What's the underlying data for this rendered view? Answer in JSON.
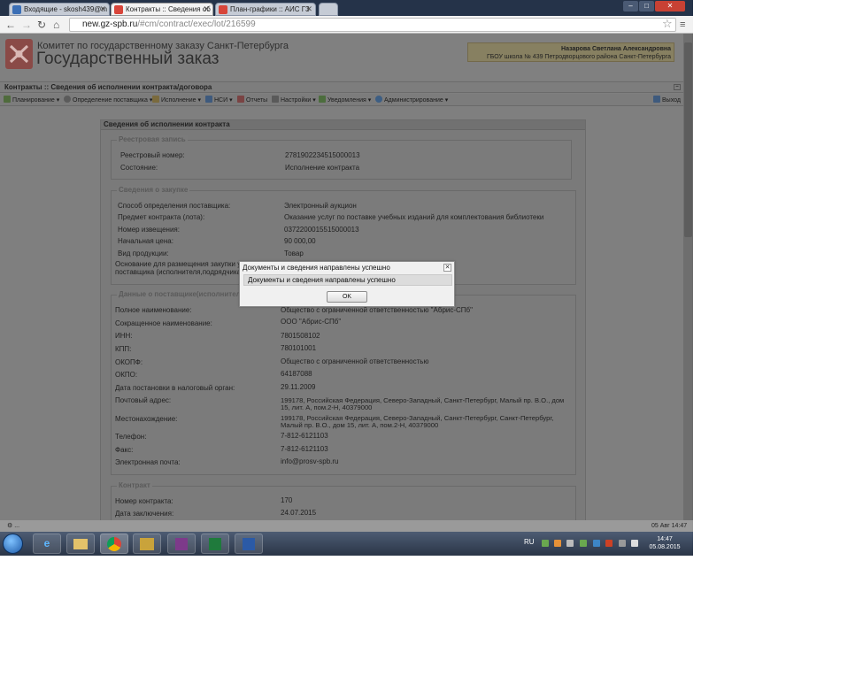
{
  "browser": {
    "tabs": [
      {
        "label": "Входящие - skosh439@m"
      },
      {
        "label": "Контракты :: Сведения об"
      },
      {
        "label": "План-графики :: АИС ГЗ"
      }
    ],
    "url_host": "new.gz-spb.ru",
    "url_path": "/#cm/contract/exec/lot/216599"
  },
  "header": {
    "org_line": "Комитет по государственному заказу Санкт-Петербурга",
    "title": "Государственный заказ",
    "user_name": "Назарова Светлана Александровна",
    "user_org": "ГБОУ школа № 439 Петродворцового района Санкт-Петербурга"
  },
  "breadcrumb": "Контракты :: Сведения об исполнении контракта/договора",
  "menu": {
    "items": [
      "Планирование",
      "Определение поставщика",
      "Исполнение",
      "НСИ",
      "Отчеты",
      "Настройки",
      "Уведомления",
      "Администрирование"
    ],
    "logout": "Выход"
  },
  "panel": {
    "title": "Сведения об исполнении контракта",
    "registry": {
      "legend": "Реестровая запись",
      "rows": [
        {
          "label": "Реестровый номер:",
          "value": "2781902234515000013"
        },
        {
          "label": "Состояние:",
          "value": "Исполнение контракта"
        }
      ]
    },
    "purchase": {
      "legend": "Сведения о закупке",
      "rows": [
        {
          "label": "Способ определения поставщика:",
          "value": "Электронный аукцион"
        },
        {
          "label": "Предмет контракта (лота):",
          "value": "Оказание услуг по поставке учебных изданий для комплектования библиотеки"
        },
        {
          "label": "Номер извещения:",
          "value": "0372200015515000013"
        },
        {
          "label": "Начальная цена:",
          "value": "90 000,00"
        },
        {
          "label": "Вид продукции:",
          "value": "Товар"
        }
      ],
      "basis_label_1": "Основание для размещения закупки у е",
      "basis_label_2": "поставщика (исполнителя,подрядчика):"
    },
    "supplier": {
      "legend": "Данные о поставщике(исполнителе, по",
      "rows": [
        {
          "label": "Полное наименование:",
          "value": "Общество с ограниченной ответственностью \"Абрис-СПб\""
        },
        {
          "label": "Сокращенное наименование:",
          "value": "ООО \"Абрис-СПб\""
        },
        {
          "label": "ИНН:",
          "value": "7801508102"
        },
        {
          "label": "КПП:",
          "value": "780101001"
        },
        {
          "label": "ОКОПФ:",
          "value": "Общество с ограниченной ответственностью"
        },
        {
          "label": "ОКПО:",
          "value": "64187088"
        },
        {
          "label": "Дата постановки в налоговый орган:",
          "value": "29.11.2009"
        }
      ],
      "postal_label": "Почтовый адрес:",
      "postal_1": "199178, Российская Федерация, Северо-Западный, Санкт-Петербург, Малый пр. В.О., дом",
      "postal_2": "15, лит. А, пом.2-Н, 40379000",
      "location_label": "Местонахождение:",
      "location_1": "199178, Российская Федерация, Северо-Западный, Санкт-Петербург, Санкт-Петербург,",
      "location_2": "Малый пр. В.О., дом 15, лит. А, пом.2-Н, 40379000",
      "rows2": [
        {
          "label": "Телефон:",
          "value": "7-812-6121103"
        },
        {
          "label": "Факс:",
          "value": "7-812-6121103"
        },
        {
          "label": "Электронная почта:",
          "value": "info@prosv-spb.ru"
        }
      ]
    },
    "contract": {
      "legend": "Контракт",
      "rows": [
        {
          "label": "Номер контракта:",
          "value": "170"
        },
        {
          "label": "Дата заключения:",
          "value": "24.07.2015"
        }
      ]
    }
  },
  "modal": {
    "title": "Документы и сведения направлены успешно",
    "message": "Документы и сведения направлены успешно",
    "ok": "OK"
  },
  "statusbar": {
    "left": "⚙ ...",
    "right": "05 Авг 14:47"
  },
  "taskbar": {
    "lang": "RU",
    "time": "14:47",
    "date": "05.08.2015"
  },
  "colors": {
    "chrome_frame": "#253349",
    "overlay_page": "#7f7f7f",
    "modal_bg": "#f0f0f0"
  }
}
